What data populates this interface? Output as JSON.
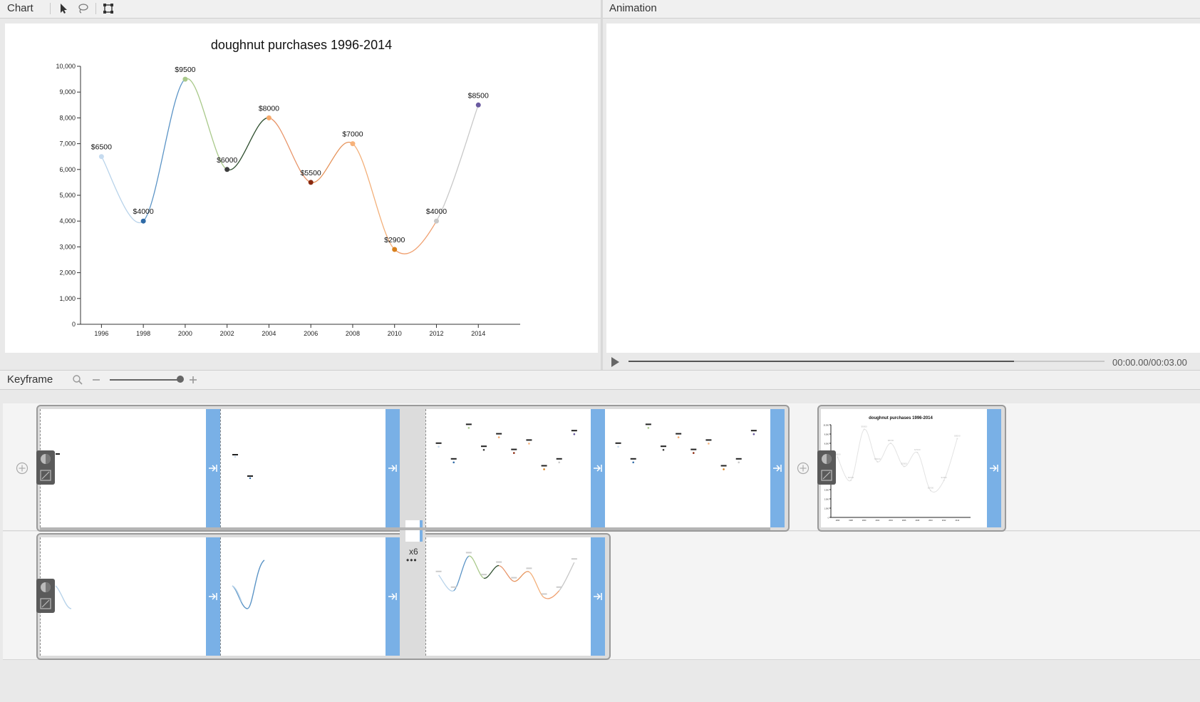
{
  "panels": {
    "chart_title": "Chart",
    "animation_title": "Animation",
    "keyframe_title": "Keyframe"
  },
  "toolbar_icons": [
    "pointer-icon",
    "lasso-icon",
    "crop-icon"
  ],
  "player": {
    "time": "00:00.00/00:03.00",
    "progress": 0.81
  },
  "zoom": {
    "level": 1.0
  },
  "keyframes": {
    "repeat_label": "x6",
    "more_label": "•••"
  },
  "chart_data": {
    "type": "line",
    "title": "doughnut purchases 1996-2014",
    "xlabel": "",
    "ylabel": "",
    "x": [
      1996,
      1998,
      2000,
      2002,
      2004,
      2006,
      2008,
      2010,
      2012,
      2014
    ],
    "values": [
      6500,
      4000,
      9500,
      6000,
      8000,
      5500,
      7000,
      2900,
      4000,
      8500
    ],
    "point_labels": [
      "$6500",
      "$4000",
      "$9500",
      "$6000",
      "$8000",
      "$5500",
      "$7000",
      "$2900",
      "$4000",
      "$8500"
    ],
    "point_colors": [
      "#c6dbef",
      "#2e6aa6",
      "#a9c98a",
      "#3d3d3d",
      "#f5a96b",
      "#8a2a0f",
      "#f7b27a",
      "#d8801c",
      "#c8c8c8",
      "#6a5aa0"
    ],
    "segment_colors": [
      "#b8d3ea",
      "#5b94c6",
      "#a9c98a",
      "#2f4f2f",
      "#e8956a",
      "#e6935a",
      "#f3b07a",
      "#f0a070",
      "#c8c8c8"
    ],
    "ylim": [
      0,
      10000
    ],
    "yticks": [
      "0",
      "1,000",
      "2,000",
      "3,000",
      "4,000",
      "5,000",
      "6,000",
      "7,000",
      "8,000",
      "9,000",
      "10,000"
    ],
    "xticks": [
      "1996",
      "1998",
      "2000",
      "2002",
      "2004",
      "2006",
      "2008",
      "2010",
      "2012",
      "2014"
    ],
    "grid": false,
    "legend": "none"
  }
}
